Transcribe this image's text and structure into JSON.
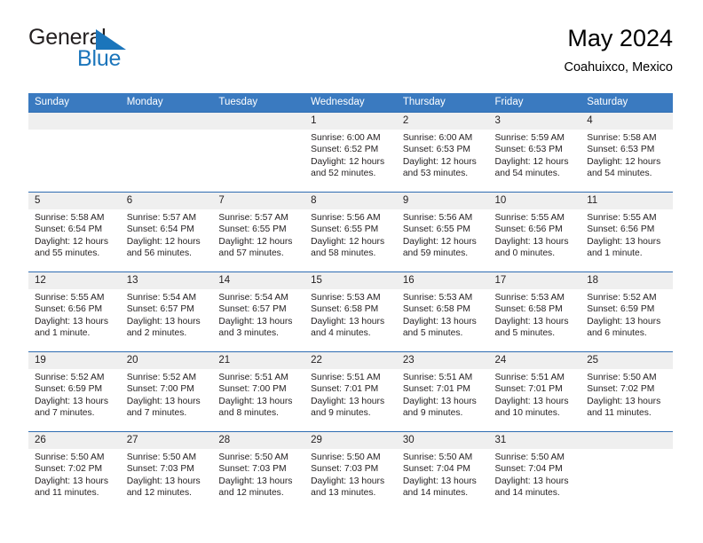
{
  "brand": {
    "word1": "General",
    "word2": "Blue",
    "mark": "blue-triangle-logo"
  },
  "header": {
    "title": "May 2024",
    "subtitle": "Coahuixco, Mexico"
  },
  "colors": {
    "header_blue": "#3a7ac0",
    "row_divider_blue": "#2f6db2",
    "daynum_band": "#efefef",
    "brand_blue": "#1b75bb",
    "text": "#231f20"
  },
  "weekdays": [
    "Sunday",
    "Monday",
    "Tuesday",
    "Wednesday",
    "Thursday",
    "Friday",
    "Saturday"
  ],
  "labels": {
    "sunrise": "Sunrise:",
    "sunset": "Sunset:",
    "daylight": "Daylight:"
  },
  "weeks": [
    [
      {
        "day": "",
        "empty": true
      },
      {
        "day": "",
        "empty": true
      },
      {
        "day": "",
        "empty": true
      },
      {
        "day": "1",
        "sunrise": "Sunrise: 6:00 AM",
        "sunset": "Sunset: 6:52 PM",
        "daylight1": "Daylight: 12 hours",
        "daylight2": "and 52 minutes."
      },
      {
        "day": "2",
        "sunrise": "Sunrise: 6:00 AM",
        "sunset": "Sunset: 6:53 PM",
        "daylight1": "Daylight: 12 hours",
        "daylight2": "and 53 minutes."
      },
      {
        "day": "3",
        "sunrise": "Sunrise: 5:59 AM",
        "sunset": "Sunset: 6:53 PM",
        "daylight1": "Daylight: 12 hours",
        "daylight2": "and 54 minutes."
      },
      {
        "day": "4",
        "sunrise": "Sunrise: 5:58 AM",
        "sunset": "Sunset: 6:53 PM",
        "daylight1": "Daylight: 12 hours",
        "daylight2": "and 54 minutes."
      }
    ],
    [
      {
        "day": "5",
        "sunrise": "Sunrise: 5:58 AM",
        "sunset": "Sunset: 6:54 PM",
        "daylight1": "Daylight: 12 hours",
        "daylight2": "and 55 minutes."
      },
      {
        "day": "6",
        "sunrise": "Sunrise: 5:57 AM",
        "sunset": "Sunset: 6:54 PM",
        "daylight1": "Daylight: 12 hours",
        "daylight2": "and 56 minutes."
      },
      {
        "day": "7",
        "sunrise": "Sunrise: 5:57 AM",
        "sunset": "Sunset: 6:55 PM",
        "daylight1": "Daylight: 12 hours",
        "daylight2": "and 57 minutes."
      },
      {
        "day": "8",
        "sunrise": "Sunrise: 5:56 AM",
        "sunset": "Sunset: 6:55 PM",
        "daylight1": "Daylight: 12 hours",
        "daylight2": "and 58 minutes."
      },
      {
        "day": "9",
        "sunrise": "Sunrise: 5:56 AM",
        "sunset": "Sunset: 6:55 PM",
        "daylight1": "Daylight: 12 hours",
        "daylight2": "and 59 minutes."
      },
      {
        "day": "10",
        "sunrise": "Sunrise: 5:55 AM",
        "sunset": "Sunset: 6:56 PM",
        "daylight1": "Daylight: 13 hours",
        "daylight2": "and 0 minutes."
      },
      {
        "day": "11",
        "sunrise": "Sunrise: 5:55 AM",
        "sunset": "Sunset: 6:56 PM",
        "daylight1": "Daylight: 13 hours",
        "daylight2": "and 1 minute."
      }
    ],
    [
      {
        "day": "12",
        "sunrise": "Sunrise: 5:55 AM",
        "sunset": "Sunset: 6:56 PM",
        "daylight1": "Daylight: 13 hours",
        "daylight2": "and 1 minute."
      },
      {
        "day": "13",
        "sunrise": "Sunrise: 5:54 AM",
        "sunset": "Sunset: 6:57 PM",
        "daylight1": "Daylight: 13 hours",
        "daylight2": "and 2 minutes."
      },
      {
        "day": "14",
        "sunrise": "Sunrise: 5:54 AM",
        "sunset": "Sunset: 6:57 PM",
        "daylight1": "Daylight: 13 hours",
        "daylight2": "and 3 minutes."
      },
      {
        "day": "15",
        "sunrise": "Sunrise: 5:53 AM",
        "sunset": "Sunset: 6:58 PM",
        "daylight1": "Daylight: 13 hours",
        "daylight2": "and 4 minutes."
      },
      {
        "day": "16",
        "sunrise": "Sunrise: 5:53 AM",
        "sunset": "Sunset: 6:58 PM",
        "daylight1": "Daylight: 13 hours",
        "daylight2": "and 5 minutes."
      },
      {
        "day": "17",
        "sunrise": "Sunrise: 5:53 AM",
        "sunset": "Sunset: 6:58 PM",
        "daylight1": "Daylight: 13 hours",
        "daylight2": "and 5 minutes."
      },
      {
        "day": "18",
        "sunrise": "Sunrise: 5:52 AM",
        "sunset": "Sunset: 6:59 PM",
        "daylight1": "Daylight: 13 hours",
        "daylight2": "and 6 minutes."
      }
    ],
    [
      {
        "day": "19",
        "sunrise": "Sunrise: 5:52 AM",
        "sunset": "Sunset: 6:59 PM",
        "daylight1": "Daylight: 13 hours",
        "daylight2": "and 7 minutes."
      },
      {
        "day": "20",
        "sunrise": "Sunrise: 5:52 AM",
        "sunset": "Sunset: 7:00 PM",
        "daylight1": "Daylight: 13 hours",
        "daylight2": "and 7 minutes."
      },
      {
        "day": "21",
        "sunrise": "Sunrise: 5:51 AM",
        "sunset": "Sunset: 7:00 PM",
        "daylight1": "Daylight: 13 hours",
        "daylight2": "and 8 minutes."
      },
      {
        "day": "22",
        "sunrise": "Sunrise: 5:51 AM",
        "sunset": "Sunset: 7:01 PM",
        "daylight1": "Daylight: 13 hours",
        "daylight2": "and 9 minutes."
      },
      {
        "day": "23",
        "sunrise": "Sunrise: 5:51 AM",
        "sunset": "Sunset: 7:01 PM",
        "daylight1": "Daylight: 13 hours",
        "daylight2": "and 9 minutes."
      },
      {
        "day": "24",
        "sunrise": "Sunrise: 5:51 AM",
        "sunset": "Sunset: 7:01 PM",
        "daylight1": "Daylight: 13 hours",
        "daylight2": "and 10 minutes."
      },
      {
        "day": "25",
        "sunrise": "Sunrise: 5:50 AM",
        "sunset": "Sunset: 7:02 PM",
        "daylight1": "Daylight: 13 hours",
        "daylight2": "and 11 minutes."
      }
    ],
    [
      {
        "day": "26",
        "sunrise": "Sunrise: 5:50 AM",
        "sunset": "Sunset: 7:02 PM",
        "daylight1": "Daylight: 13 hours",
        "daylight2": "and 11 minutes."
      },
      {
        "day": "27",
        "sunrise": "Sunrise: 5:50 AM",
        "sunset": "Sunset: 7:03 PM",
        "daylight1": "Daylight: 13 hours",
        "daylight2": "and 12 minutes."
      },
      {
        "day": "28",
        "sunrise": "Sunrise: 5:50 AM",
        "sunset": "Sunset: 7:03 PM",
        "daylight1": "Daylight: 13 hours",
        "daylight2": "and 12 minutes."
      },
      {
        "day": "29",
        "sunrise": "Sunrise: 5:50 AM",
        "sunset": "Sunset: 7:03 PM",
        "daylight1": "Daylight: 13 hours",
        "daylight2": "and 13 minutes."
      },
      {
        "day": "30",
        "sunrise": "Sunrise: 5:50 AM",
        "sunset": "Sunset: 7:04 PM",
        "daylight1": "Daylight: 13 hours",
        "daylight2": "and 14 minutes."
      },
      {
        "day": "31",
        "sunrise": "Sunrise: 5:50 AM",
        "sunset": "Sunset: 7:04 PM",
        "daylight1": "Daylight: 13 hours",
        "daylight2": "and 14 minutes."
      },
      {
        "day": "",
        "empty": true
      }
    ]
  ]
}
